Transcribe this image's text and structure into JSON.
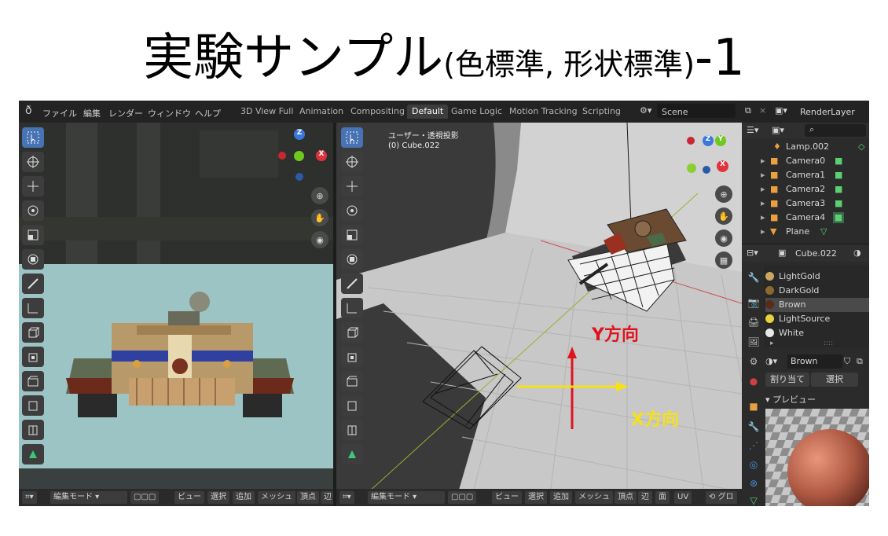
{
  "slide": {
    "title_main": "実験サンプル",
    "title_sub": "(色標準, 形状標準)",
    "title_suffix": "-1"
  },
  "menu": {
    "items": [
      "ファイル",
      "編集",
      "レンダー",
      "ウィンドウ",
      "ヘルプ"
    ]
  },
  "workspaces": {
    "tabs": [
      "3D View Full",
      "Animation",
      "Compositing",
      "Default",
      "Game Logic",
      "Motion Tracking",
      "Scripting"
    ],
    "active": "Default"
  },
  "scene": {
    "scene_name": "Scene",
    "render_layer": "RenderLayer"
  },
  "viewport_main": {
    "view_label": "ユーザー・透視投影",
    "object_label": "(0) Cube.022",
    "annotation_y": "Y方向",
    "annotation_x": "X方向"
  },
  "bottom_bar": {
    "mode": "編集モード",
    "buttons": [
      "ビュー",
      "選択",
      "追加",
      "メッシュ",
      "頂点",
      "辺",
      "面",
      "UV"
    ],
    "cut_label": "グロ"
  },
  "outliner": {
    "items": [
      {
        "name": "Lamp.002",
        "icon": "lamp-icon"
      },
      {
        "name": "Camera0",
        "icon": "camera-icon"
      },
      {
        "name": "Camera1",
        "icon": "camera-icon"
      },
      {
        "name": "Camera2",
        "icon": "camera-icon"
      },
      {
        "name": "Camera3",
        "icon": "camera-icon"
      },
      {
        "name": "Camera4",
        "icon": "camera-icon"
      },
      {
        "name": "Plane",
        "icon": "mesh-icon"
      }
    ]
  },
  "properties": {
    "object_name": "Cube.022",
    "materials": [
      {
        "name": "LightGold",
        "color": "#c8a860"
      },
      {
        "name": "DarkGold",
        "color": "#8a6a30"
      },
      {
        "name": "Brown",
        "color": "#5a2a1a"
      },
      {
        "name": "LightSource",
        "color": "#e8d040"
      },
      {
        "name": "White",
        "color": "#e8e8e8"
      }
    ],
    "selected_material": "Brown",
    "current_material": "Brown",
    "assign_label": "割り当て",
    "select_label": "選択",
    "preview_label": "プレビュー"
  },
  "colors": {
    "annotation_red": "#e0141e",
    "annotation_yellow": "#f5e01a",
    "axis_x": "#e0323c",
    "axis_y": "#6ec81e",
    "axis_z": "#3c78dc",
    "selection_blue": "#4772b3"
  }
}
